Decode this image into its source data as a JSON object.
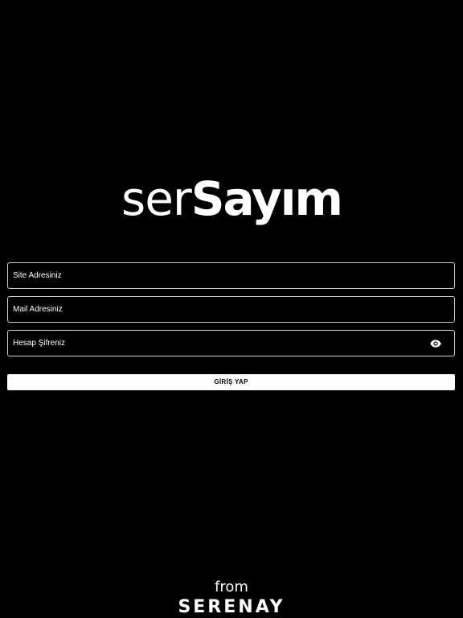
{
  "app": {
    "logo_light": "ser",
    "logo_bold": "Sayım"
  },
  "form": {
    "site_placeholder": "Site Adresiniz",
    "mail_placeholder": "Mail Adresiniz",
    "password_placeholder": "Hesap Şifreniz",
    "password_toggle_icon": "eye-icon",
    "submit_label": "GİRİŞ YAP"
  },
  "footer": {
    "from_label": "from",
    "brand_name": "SERENAY"
  },
  "colors": {
    "background": "#000000",
    "foreground": "#ffffff",
    "border": "#cfcfcf"
  }
}
